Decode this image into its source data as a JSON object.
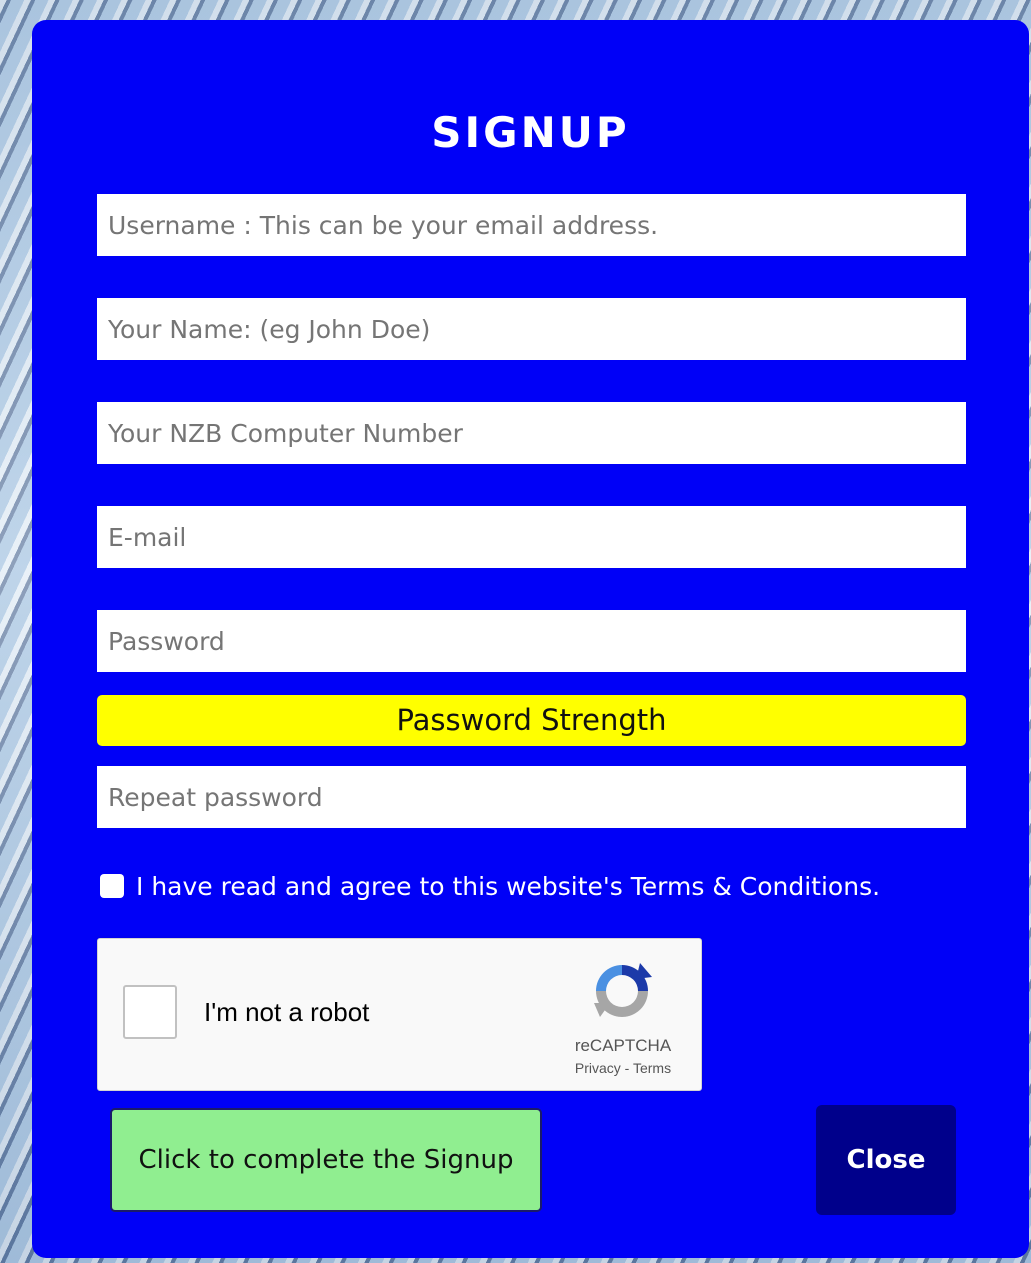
{
  "signup": {
    "title": "SIGNUP",
    "fields": {
      "username_placeholder": "Username : This can be your email address.",
      "name_placeholder": "Your Name: (eg John Doe)",
      "nzb_placeholder": "Your NZB Computer Number",
      "email_placeholder": "E-mail",
      "password_placeholder": "Password",
      "repeat_password_placeholder": "Repeat password"
    },
    "password_strength_label": "Password Strength",
    "terms_label": "I have read and agree to this website's Terms & Conditions.",
    "captcha": {
      "label": "I'm not a robot",
      "brand": "reCAPTCHA",
      "privacy": "Privacy",
      "separator": " - ",
      "terms": "Terms",
      "icon": "recaptcha-logo"
    },
    "submit_label": "Click to complete the Signup",
    "close_label": "Close"
  },
  "colors": {
    "modal_background": "#0000f7",
    "strength_bar": "#ffff00",
    "submit_button": "#90ee90",
    "close_button": "#00008b"
  }
}
